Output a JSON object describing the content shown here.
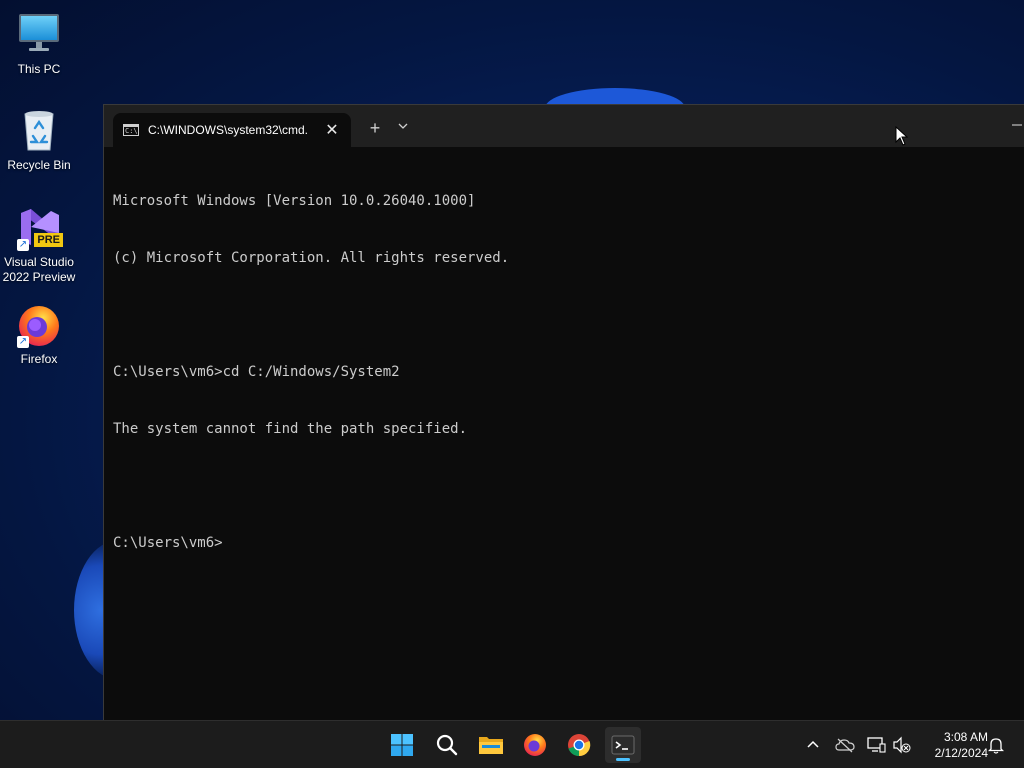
{
  "desktop": {
    "icons": [
      {
        "label": "This PC",
        "icon": "monitor-icon"
      },
      {
        "label": "Recycle Bin",
        "icon": "recycle-bin-icon"
      },
      {
        "label": "Visual Studio\n2022 Preview",
        "label_line1": "Visual Studio",
        "label_line2": "2022 Preview",
        "icon": "visual-studio-icon",
        "badge": "PRE"
      },
      {
        "label": "Firefox",
        "icon": "firefox-icon"
      }
    ]
  },
  "terminal": {
    "tab_title": "C:\\WINDOWS\\system32\\cmd.",
    "tab_close_glyph": "✕",
    "new_tab_glyph": "+",
    "dropdown_glyph": "⌄",
    "minimize_glyph": "—",
    "lines": [
      "Microsoft Windows [Version 10.0.26040.1000]",
      "(c) Microsoft Corporation. All rights reserved.",
      "",
      "C:\\Users\\vm6>cd C:/Windows/System2",
      "The system cannot find the path specified.",
      "",
      "C:\\Users\\vm6>"
    ],
    "colors": {
      "background": "#0c0c0c",
      "text": "#cccccc",
      "titlebar": "#202020"
    }
  },
  "taskbar": {
    "apps": [
      "start-icon",
      "search-icon",
      "file-explorer-icon",
      "firefox-icon",
      "chrome-icon",
      "terminal-icon"
    ],
    "active_app": "terminal-icon",
    "tray": [
      "chevron-up-icon",
      "onedrive-offline-icon",
      "network-icon",
      "volume-muted-icon",
      "notification-bell-icon"
    ],
    "clock": {
      "time": "3:08 AM",
      "date": "2/12/2024"
    },
    "accent": "#4cc2ff"
  }
}
